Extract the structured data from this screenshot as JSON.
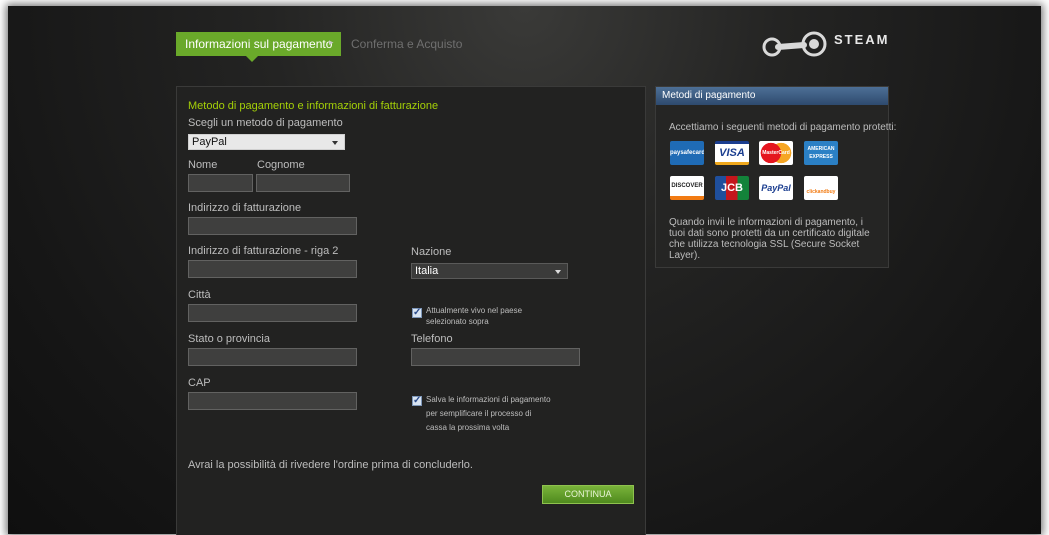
{
  "steps": {
    "active": "Informazioni sul pagamento",
    "next": "Conferma e Acquisto",
    "separator": "▸"
  },
  "brand": {
    "logo_text": "STEAM"
  },
  "form": {
    "section_title": "Metodo di pagamento e informazioni di fatturazione",
    "payment_method_label": "Scegli un metodo di pagamento",
    "payment_method_value": "PayPal",
    "first_name_label": "Nome",
    "last_name_label": "Cognome",
    "address_label": "Indirizzo di fatturazione",
    "address2_label": "Indirizzo di fatturazione - riga 2",
    "city_label": "Città",
    "state_label": "Stato o provincia",
    "zip_label": "CAP",
    "country_label": "Nazione",
    "country_value": "Italia",
    "live_in_country_line1": "Attualmente vivo nel paese",
    "live_in_country_line2": "selezionato sopra",
    "phone_label": "Telefono",
    "save_info_line1": "Salva le informazioni di pagamento",
    "save_info_line2": "per semplificare il processo di",
    "save_info_line3": "cassa la prossima volta",
    "review_note": "Avrai la possibilità di rivedere l'ordine prima di concluderlo.",
    "continue_label": "CONTINUA"
  },
  "payment_methods": {
    "title": "Metodi di pagamento",
    "intro": "Accettiamo i seguenti metodi di pagamento protetti:",
    "cards": [
      {
        "label": "paysafecard",
        "icon": "paysafecard-icon"
      },
      {
        "label": "VISA",
        "icon": "visa-icon"
      },
      {
        "label": "MasterCard",
        "icon": "mastercard-icon"
      },
      {
        "label": "AMERICAN EXPRESS",
        "icon": "amex-icon"
      },
      {
        "label": "DISCOVER",
        "icon": "discover-icon"
      },
      {
        "label": "JCB",
        "icon": "jcb-icon"
      },
      {
        "label": "PayPal",
        "icon": "paypal-icon"
      },
      {
        "label": "clickandbuy",
        "icon": "clickandbuy-icon"
      }
    ],
    "footer": "Quando invii le informazioni di pagamento, i tuoi dati sono protetti da un certificato digitale che utilizza tecnologia SSL (Secure Socket Layer)."
  },
  "colors": {
    "accent_green": "#6aa92a",
    "section_title_green": "#a4d007",
    "header_blue": "#3c5c82",
    "background": "#1b1b1a"
  }
}
